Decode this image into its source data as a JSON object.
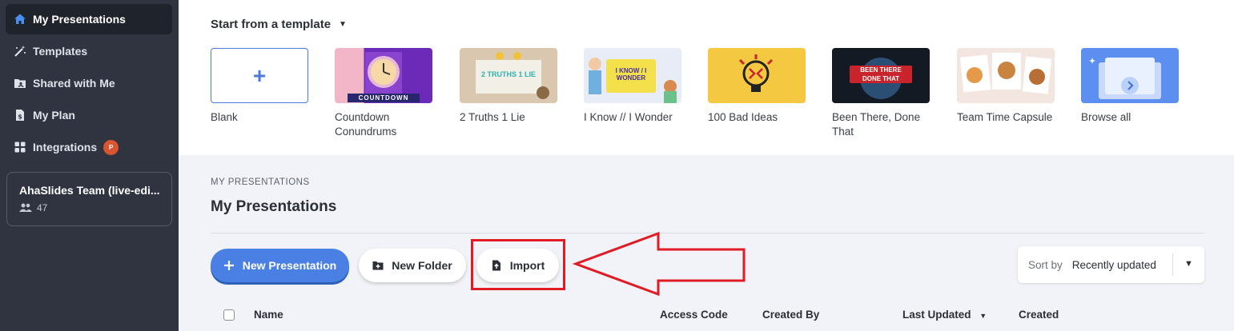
{
  "sidebar": {
    "items": [
      {
        "label": "My Presentations",
        "icon": "home-icon",
        "active": true
      },
      {
        "label": "Templates",
        "icon": "magic-wand-icon"
      },
      {
        "label": "Shared with Me",
        "icon": "shared-folder-icon"
      },
      {
        "label": "My Plan",
        "icon": "document-dollar-icon"
      },
      {
        "label": "Integrations",
        "icon": "grid-icon",
        "badge": "P"
      }
    ],
    "team": {
      "name": "AhaSlides Team (live-edi...",
      "members": "47"
    }
  },
  "templates": {
    "header": "Start from a template",
    "items": [
      {
        "label": "Blank"
      },
      {
        "label": "Countdown Conundrums",
        "thumb_text": "COUNTDOWN"
      },
      {
        "label": "2 Truths 1 Lie",
        "thumb_text": "2 TRUTHS 1 LIE"
      },
      {
        "label": "I Know // I Wonder",
        "thumb_text": "I KNOW / I WONDER"
      },
      {
        "label": "100 Bad Ideas"
      },
      {
        "label": "Been There, Done That",
        "thumb_text": "BEEN THERE DONE THAT"
      },
      {
        "label": "Team Time Capsule"
      },
      {
        "label": "Browse all"
      }
    ]
  },
  "main": {
    "eyebrow": "MY PRESENTATIONS",
    "title": "My Presentations",
    "buttons": {
      "new_presentation": "New Presentation",
      "new_folder": "New Folder",
      "import": "Import"
    },
    "sort": {
      "label": "Sort by",
      "value": "Recently updated"
    },
    "table_headers": [
      "Name",
      "Access Code",
      "Created By",
      "Last Updated",
      "Created"
    ]
  },
  "colors": {
    "accent": "#4a7fe3",
    "sidebar": "#2f3440",
    "annotation": "#e01b24"
  }
}
